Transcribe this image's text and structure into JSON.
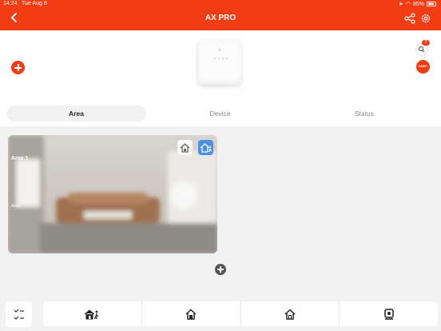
{
  "status_bar": {
    "time": "14:24",
    "date": "Tue Aug 8",
    "battery": "85%"
  },
  "header": {
    "title": "AX PRO",
    "back_icon": "chevron-left-icon",
    "share_icon": "share-icon",
    "settings_icon": "gear-icon",
    "color": "#f23c14"
  },
  "top_panel": {
    "search_badge": "2",
    "panic_label": "PANIC"
  },
  "tabs": [
    {
      "label": "Area",
      "active": true
    },
    {
      "label": "Device",
      "active": false
    },
    {
      "label": "Status",
      "active": false
    }
  ],
  "area_card": {
    "name": "Area 1",
    "status": "Away",
    "home_mode_icon": "stay-home-icon",
    "away_mode_icon": "away-home-icon"
  },
  "bottom_actions": [
    {
      "icon": "away-arm-icon"
    },
    {
      "icon": "stay-arm-icon"
    },
    {
      "icon": "disarm-icon"
    },
    {
      "icon": "clear-alarm-icon"
    }
  ]
}
